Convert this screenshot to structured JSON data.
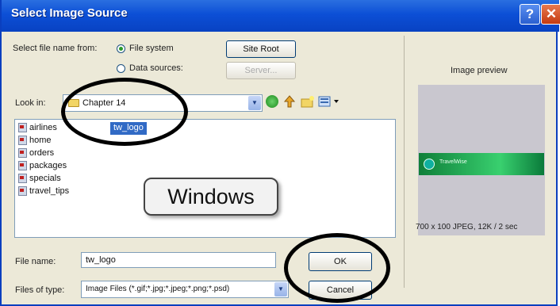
{
  "window": {
    "title": "Select Image Source",
    "help_glyph": "?",
    "close_glyph": "✕"
  },
  "source": {
    "label": "Select file name from:",
    "options": [
      {
        "label": "File system",
        "selected": true
      },
      {
        "label": "Data sources:",
        "selected": false
      }
    ],
    "site_root_button": "Site Root",
    "server_button": "Server..."
  },
  "look_in": {
    "label": "Look in:",
    "value": "Chapter 14"
  },
  "toolbar_icons": [
    "back-icon",
    "up-folder-icon",
    "new-folder-icon",
    "view-menu-icon"
  ],
  "files": [
    "airlines",
    "home",
    "orders",
    "packages",
    "specials",
    "travel_tips"
  ],
  "selected_file": "tw_logo",
  "file_name": {
    "label": "File name:",
    "value": "tw_logo"
  },
  "file_type": {
    "label": "Files of type:",
    "value": "Image Files (*.gif;*.jpg;*.jpeg;*.png;*.psd)"
  },
  "buttons": {
    "ok": "OK",
    "cancel": "Cancel"
  },
  "preview": {
    "heading": "Image preview",
    "logo_text": "TravelWise",
    "info": "700 x 100 JPEG, 12K / 2 sec"
  },
  "callout": "Windows",
  "colors": {
    "titlebar": "#0c4fd6",
    "dialog_bg": "#ece9d8",
    "selection": "#316ac5",
    "logo_green": "#39d06f"
  }
}
